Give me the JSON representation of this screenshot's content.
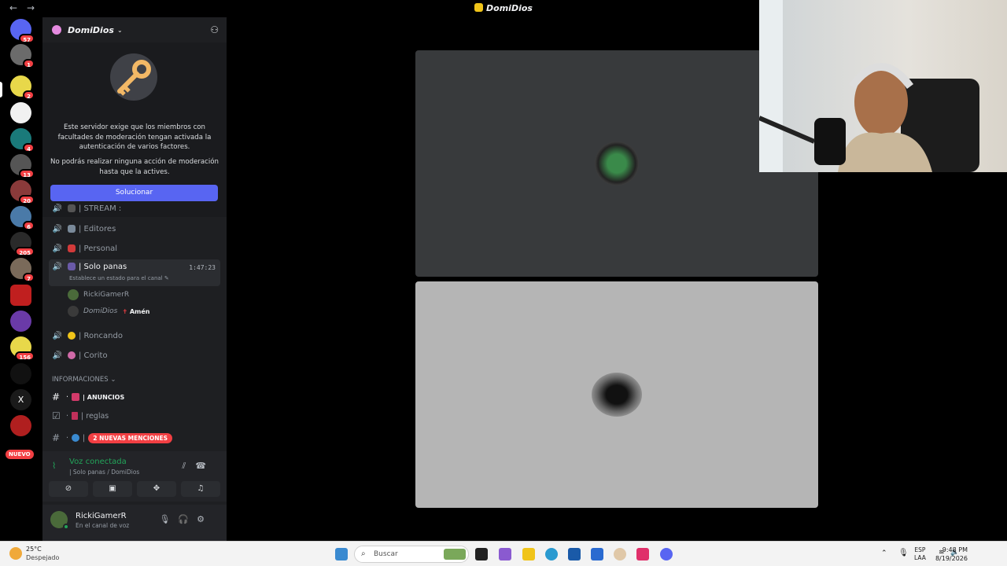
{
  "window": {
    "title": "DomiDios",
    "back": "←",
    "forward": "→"
  },
  "rail_badges": [
    "57",
    "1",
    "2",
    "4",
    "13",
    "20",
    "6",
    "205",
    "7",
    "156"
  ],
  "rail_nuevo": "NUEVO",
  "server": {
    "name": "DomiDios"
  },
  "mfa": {
    "line1": "Este servidor exige que los miembros con facultades de moderación tengan activada la autenticación de varios factores.",
    "line2": "No podrás realizar ninguna acción de moderación hasta que la actives.",
    "button": "Solucionar"
  },
  "channels": {
    "stream": "| STREAM :",
    "editores": "| Editores",
    "personal": "| Personal",
    "solo_panas": "| Solo panas",
    "solo_duration": "1:47:23",
    "solo_status": "Establece un estado para el canal",
    "roncando": "| Roncando",
    "corito": "| Corito"
  },
  "members": [
    {
      "name": "RickiGamerR",
      "tag": ""
    },
    {
      "name": "DomiDios",
      "tag": "Amén"
    }
  ],
  "category": "INFORMACIONES",
  "text_channels": {
    "anuncios": "ANUNCIOS",
    "reglas": "reglas",
    "mentions": "2 NUEVAS MENCIONES"
  },
  "voice": {
    "title": "Voz conectada",
    "sub": "| Solo panas / DomiDios"
  },
  "user": {
    "name": "RickiGamerR",
    "status": "En el canal de voz"
  },
  "taskbar": {
    "temp": "25°C",
    "condition": "Despejado",
    "search": "Buscar",
    "lang1": "ESP",
    "lang2": "LAA",
    "time": "9:48 PM",
    "date": "8/19/2026"
  },
  "colors": {
    "blurple": "#5865f2",
    "green": "#23a55a",
    "red": "#f23f43"
  }
}
